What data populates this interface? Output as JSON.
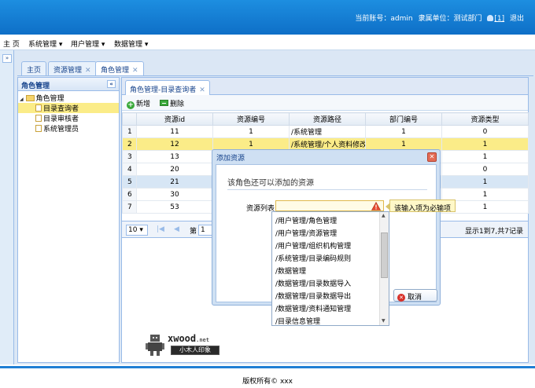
{
  "header": {
    "account_label": "当前账号：",
    "account": "admin",
    "unit_label": "隶属单位：",
    "unit": "测试部门",
    "count": "[1]",
    "logout": "退出"
  },
  "menu": {
    "home": "主 页",
    "items": [
      "系统管理 ▾",
      "用户管理 ▾",
      "数据管理 ▾"
    ]
  },
  "expand_glyph": "»",
  "top_tabs": [
    {
      "label": "主页",
      "closable": false
    },
    {
      "label": "资源管理",
      "closable": true
    },
    {
      "label": "角色管理",
      "closable": true
    }
  ],
  "close_glyph": "✕",
  "left_panel": {
    "title": "角色管理",
    "collapse_glyph": "«",
    "tree_toggle": "◢",
    "root": "角色管理",
    "children": [
      "目录查询者",
      "目录审核者",
      "系统管理员"
    ],
    "selected": 0
  },
  "sub_tab": {
    "label": "角色管理-目录查询者"
  },
  "toolbar": {
    "add": "新增",
    "delete": "删除"
  },
  "grid": {
    "columns": [
      "资源id",
      "资源编号",
      "资源路径",
      "部门编号",
      "资源类型"
    ],
    "rows": [
      {
        "n": "1",
        "id": "11",
        "code": "1",
        "path": "/系统管理",
        "dept": "1",
        "type": "0"
      },
      {
        "n": "2",
        "id": "12",
        "code": "1",
        "path": "/系统管理/个人资料修改",
        "dept": "1",
        "type": "1"
      },
      {
        "n": "3",
        "id": "13",
        "code": "",
        "path": "",
        "dept": "",
        "type": "1"
      },
      {
        "n": "4",
        "id": "20",
        "code": "",
        "path": "",
        "dept": "",
        "type": "0"
      },
      {
        "n": "5",
        "id": "21",
        "code": "",
        "path": "",
        "dept": "",
        "type": "1"
      },
      {
        "n": "6",
        "id": "30",
        "code": "",
        "path": "",
        "dept": "",
        "type": "1"
      },
      {
        "n": "7",
        "id": "53",
        "code": "",
        "path": "",
        "dept": "",
        "type": "1"
      }
    ],
    "selected_row": 1,
    "highlight_row": 4
  },
  "pager": {
    "page_size": "10 ▾",
    "first": "|◀",
    "prev": "◀",
    "page_label": "第",
    "page": "1",
    "info": "显示1到7,共7记录"
  },
  "footer": {
    "copyright": "版权所有© xxx"
  },
  "watermark": {
    "text": "xwood",
    "suffix": ".net",
    "sub": "小木人印象"
  },
  "dialog": {
    "title": "添加资源",
    "close_glyph": "✕",
    "heading": "该角色还可以添加的资源",
    "field_label": "资源列表",
    "tooltip": "该输入项为必输项",
    "cancel": "取消",
    "cancel_glyph": "✕"
  },
  "dropdown": {
    "items": [
      "/用户管理/角色管理",
      "/用户管理/资源管理",
      "/用户管理/组织机构管理",
      "/系统管理/目录编码规则",
      "/数据管理",
      "/数据管理/目录数据导入",
      "/数据管理/目录数据导出",
      "/数据管理/资料通知管理",
      "/目录信息管理"
    ],
    "up_glyph": "▲",
    "down_glyph": "▼"
  },
  "colors": {
    "header_blue": "#1d8ee0",
    "selected_row": "#fbec88",
    "highlight_row": "#d7e6f5",
    "tooltip_bg": "#fff8c8"
  }
}
